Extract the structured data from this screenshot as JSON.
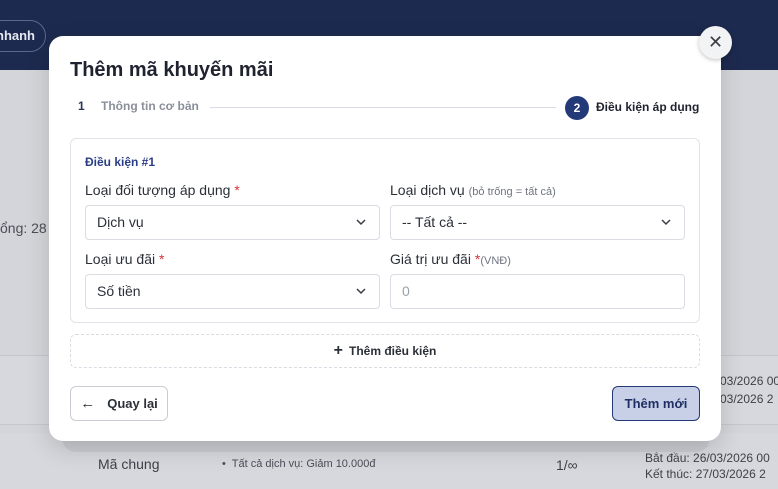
{
  "background": {
    "quick_button": "nhanh",
    "total_text": "ổng: 28",
    "row1": {
      "start_date": "03/2026 00",
      "end_date": "03/2026 2"
    },
    "row2": {
      "code_type": "Mã chung",
      "description": "Tất cả dịch vụ: Giảm 10.000đ",
      "usage": "1/∞",
      "start_date": "Bắt đầu: 26/03/2026 00",
      "end_date": "Kết thúc: 27/03/2026 2"
    }
  },
  "modal": {
    "title": "Thêm mã khuyến mãi",
    "close_icon": "close-icon",
    "steps": [
      {
        "number": "1",
        "label": "Thông tin cơ bản",
        "state": "done"
      },
      {
        "number": "2",
        "label": "Điều kiện áp dụng",
        "state": "active"
      }
    ],
    "condition": {
      "title": "Điều kiện #1",
      "target_type": {
        "label": "Loại đối tượng áp dụng",
        "required": "*",
        "value": "Dịch vụ"
      },
      "service_type": {
        "label": "Loại dịch vụ",
        "hint": "(bỏ trống = tất cả)",
        "value": "-- Tất cả --"
      },
      "discount_type": {
        "label": "Loại ưu đãi",
        "required": "*",
        "value": "Số tiền"
      },
      "discount_value": {
        "label": "Giá trị ưu đãi",
        "required": "*",
        "unit": "(VNĐ)",
        "placeholder": "0"
      }
    },
    "add_condition": {
      "icon": "plus-icon",
      "label": "Thêm điều kiện"
    },
    "back_button": {
      "icon": "arrow-left-icon",
      "label": "Quay lại"
    },
    "submit_button": {
      "label": "Thêm mới"
    },
    "accent_color": "#243a78"
  }
}
